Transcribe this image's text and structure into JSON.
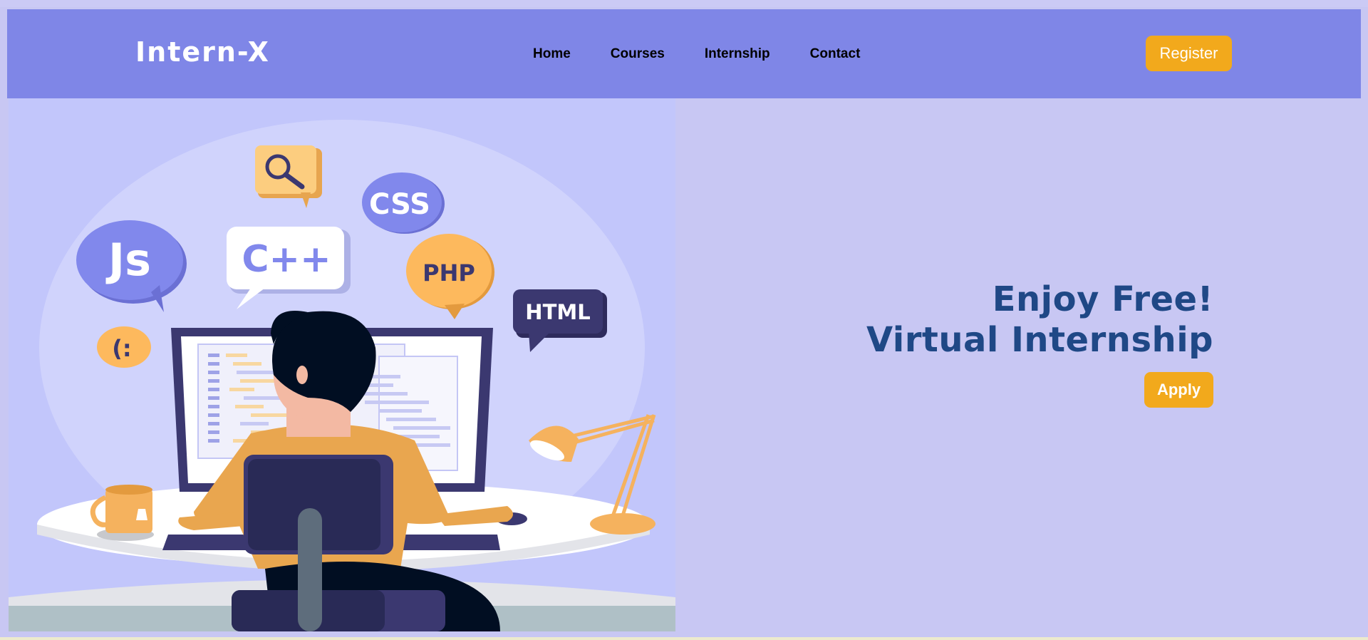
{
  "navbar": {
    "logo": "Intern-X",
    "links": [
      "Home",
      "Courses",
      "Internship",
      "Contact"
    ],
    "register_label": "Register"
  },
  "hero": {
    "headline_line1": "Enjoy Free!",
    "headline_line2": "Virtual Internship",
    "apply_label": "Apply",
    "illustration": {
      "bubbles": [
        "Js",
        "C++",
        "CSS",
        "PHP",
        "HTML",
        "(:"
      ]
    }
  },
  "colors": {
    "navbar_bg": "#7f86e7",
    "page_bg": "#c8c7f3",
    "accent": "#f2a91c",
    "headline": "#1f4886"
  }
}
